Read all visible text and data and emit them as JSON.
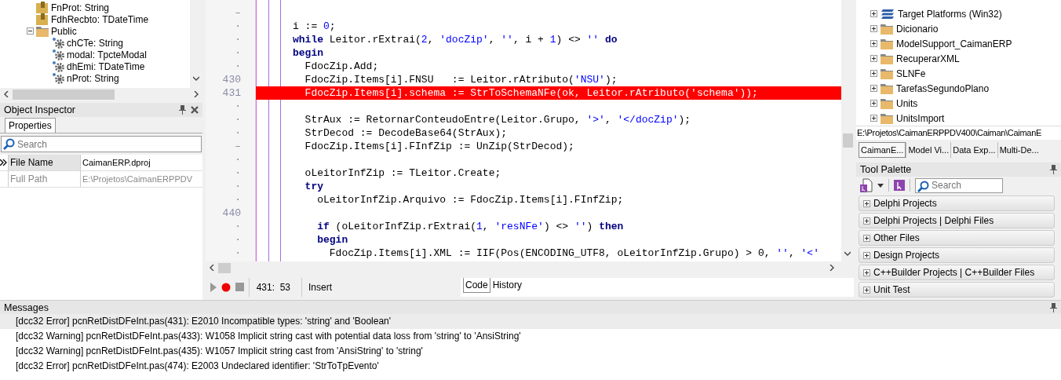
{
  "structure_tree": {
    "items": [
      {
        "label": "FnProt: String",
        "kind": "field"
      },
      {
        "label": "FdhRecbto: TDateTime",
        "kind": "field"
      },
      {
        "label": "Public",
        "kind": "folder",
        "expanded": true,
        "children": [
          {
            "label": "chCTe: String",
            "kind": "property"
          },
          {
            "label": "modal: TpcteModal",
            "kind": "property"
          },
          {
            "label": "dhEmi: TDateTime",
            "kind": "property"
          },
          {
            "label": "nProt: String",
            "kind": "property"
          }
        ]
      }
    ]
  },
  "object_inspector": {
    "title": "Object Inspector",
    "tabs": [
      {
        "label": "Properties",
        "selected": true
      }
    ],
    "search": {
      "placeholder": "Search"
    },
    "properties": [
      {
        "name": "File Name",
        "value": "CaimanERP.dproj",
        "selected": true,
        "readonly": false
      },
      {
        "name": "Full Path",
        "value": "E:\\Projetos\\CaimanERPPDV",
        "selected": false,
        "readonly": true
      }
    ]
  },
  "editor": {
    "lines": [
      {
        "gutter": "–",
        "error": false
      },
      {
        "gutter": "·",
        "error": false,
        "tokens": [
          {
            "kind": "plain",
            "text": "i := "
          },
          {
            "kind": "num",
            "text": "0"
          },
          {
            "kind": "plain",
            "text": ";"
          }
        ]
      },
      {
        "gutter": "·",
        "error": false,
        "tokens": [
          {
            "kind": "kw",
            "text": "while"
          },
          {
            "kind": "plain",
            "text": " Leitor.rExtrai("
          },
          {
            "kind": "num",
            "text": "2"
          },
          {
            "kind": "plain",
            "text": ", "
          },
          {
            "kind": "str",
            "text": "'docZip'"
          },
          {
            "kind": "plain",
            "text": ", "
          },
          {
            "kind": "str",
            "text": "''"
          },
          {
            "kind": "plain",
            "text": ", i + "
          },
          {
            "kind": "num",
            "text": "1"
          },
          {
            "kind": "plain",
            "text": ") <> "
          },
          {
            "kind": "str",
            "text": "''"
          },
          {
            "kind": "kw",
            "text": " do"
          }
        ]
      },
      {
        "gutter": "·",
        "error": false,
        "tokens": [
          {
            "kind": "kw",
            "text": "begin"
          }
        ]
      },
      {
        "gutter": "·",
        "error": false,
        "tokens": [
          {
            "kind": "plain",
            "text": "  FdocZip.Add;"
          }
        ]
      },
      {
        "gutter": "430",
        "error": false,
        "tokens": [
          {
            "kind": "plain",
            "text": "  FdocZip.Items[i].FNSU   := Leitor.rAtributo("
          },
          {
            "kind": "str",
            "text": "'NSU'"
          },
          {
            "kind": "plain",
            "text": ");"
          }
        ]
      },
      {
        "gutter": "431",
        "error": true,
        "tokens": [
          {
            "kind": "plain",
            "text": "  FdocZip.Items[i].schema := StrToSchemaNFe(ok, Leitor.rAtributo("
          },
          {
            "kind": "str",
            "text": "'schema'"
          },
          {
            "kind": "plain",
            "text": "));"
          }
        ]
      },
      {
        "gutter": "·",
        "error": false
      },
      {
        "gutter": "·",
        "error": false,
        "tokens": [
          {
            "kind": "plain",
            "text": "  StrAux := RetornarConteudoEntre(Leitor.Grupo, "
          },
          {
            "kind": "str",
            "text": "'>'"
          },
          {
            "kind": "plain",
            "text": ", "
          },
          {
            "kind": "str",
            "text": "'</docZip'"
          },
          {
            "kind": "plain",
            "text": ");"
          }
        ]
      },
      {
        "gutter": "·",
        "error": false,
        "tokens": [
          {
            "kind": "plain",
            "text": "  StrDecod := DecodeBase64(StrAux);"
          }
        ]
      },
      {
        "gutter": "–",
        "error": false,
        "tokens": [
          {
            "kind": "plain",
            "text": "  FdocZip.Items[i].FInfZip := UnZip(StrDecod);"
          }
        ]
      },
      {
        "gutter": "·",
        "error": false
      },
      {
        "gutter": "·",
        "error": false,
        "tokens": [
          {
            "kind": "plain",
            "text": "  oLeitorInfZip := TLeitor.Create;"
          }
        ]
      },
      {
        "gutter": "·",
        "error": false,
        "tokens": [
          {
            "kind": "kw",
            "text": "  try"
          }
        ]
      },
      {
        "gutter": "·",
        "error": false,
        "tokens": [
          {
            "kind": "plain",
            "text": "    oLeitorInfZip.Arquivo := FdocZip.Items[i].FInfZip;"
          }
        ]
      },
      {
        "gutter": "440",
        "error": false
      },
      {
        "gutter": "·",
        "error": false,
        "tokens": [
          {
            "kind": "kw",
            "text": "    if"
          },
          {
            "kind": "plain",
            "text": " (oLeitorInfZip.rExtrai("
          },
          {
            "kind": "num",
            "text": "1"
          },
          {
            "kind": "plain",
            "text": ", "
          },
          {
            "kind": "str",
            "text": "'resNFe'"
          },
          {
            "kind": "plain",
            "text": ") <> "
          },
          {
            "kind": "str",
            "text": "''"
          },
          {
            "kind": "plain",
            "text": ") "
          },
          {
            "kind": "kw",
            "text": "then"
          }
        ]
      },
      {
        "gutter": "·",
        "error": false,
        "tokens": [
          {
            "kind": "kw",
            "text": "    begin"
          }
        ]
      },
      {
        "gutter": "·",
        "error": false,
        "tokens": [
          {
            "kind": "plain",
            "text": "      FdocZip.Items[i].XML := IIF(Pos(ENCODING_UTF8, oLeitorInfZip.Grupo) > 0, "
          },
          {
            "kind": "str",
            "text": "''"
          },
          {
            "kind": "plain",
            "text": ", "
          },
          {
            "kind": "str",
            "text": "'<'"
          }
        ]
      }
    ],
    "status": {
      "position": "431:  53",
      "mode": "Insert"
    },
    "tabs": [
      {
        "label": "Code",
        "selected": true
      },
      {
        "label": "History",
        "selected": false
      }
    ]
  },
  "project_tree": {
    "items": [
      {
        "label": "Target Platforms (Win32)",
        "kind": "platforms",
        "expanded": false
      },
      {
        "label": "Dicionario",
        "kind": "folder",
        "expanded": false
      },
      {
        "label": "ModelSupport_CaimanERP",
        "kind": "folder",
        "expanded": false
      },
      {
        "label": "RecuperarXML",
        "kind": "folder",
        "expanded": false
      },
      {
        "label": "SLNFe",
        "kind": "folder",
        "expanded": false
      },
      {
        "label": "TarefasSegundoPlano",
        "kind": "folder",
        "expanded": false
      },
      {
        "label": "Units",
        "kind": "folder",
        "expanded": false
      },
      {
        "label": "UnitsImport",
        "kind": "folder",
        "expanded": false
      }
    ],
    "path": "E:\\Projetos\\CaimanERPPDV400\\Caiman\\CaimanE",
    "tabs": [
      {
        "label": "CaimanE...",
        "selected": true
      },
      {
        "label": "Model Vi...",
        "selected": false
      },
      {
        "label": "Data Exp...",
        "selected": false
      },
      {
        "label": "Multi-De...",
        "selected": false
      }
    ]
  },
  "tool_palette": {
    "title": "Tool Palette",
    "search": {
      "placeholder": "Search"
    },
    "categories": [
      {
        "label": "Delphi Projects",
        "expanded": false
      },
      {
        "label": "Delphi Projects | Delphi Files",
        "expanded": false
      },
      {
        "label": "Other Files",
        "expanded": false
      },
      {
        "label": "Design Projects",
        "expanded": false
      },
      {
        "label": "C++Builder Projects | C++Builder Files",
        "expanded": false
      },
      {
        "label": "Unit Test",
        "expanded": false
      }
    ]
  },
  "messages": {
    "title": "Messages",
    "items": [
      {
        "text": "[dcc32 Error] pcnRetDistDFeInt.pas(431): E2010 Incompatible types: 'string' and 'Boolean'",
        "selected": true
      },
      {
        "text": "[dcc32 Warning] pcnRetDistDFeInt.pas(433): W1058 Implicit string cast with potential data loss from 'string' to 'AnsiString'",
        "selected": false
      },
      {
        "text": "[dcc32 Warning] pcnRetDistDFeInt.pas(435): W1057 Implicit string cast from 'AnsiString' to 'string'",
        "selected": false
      },
      {
        "text": "[dcc32 Error] pcnRetDistDFeInt.pas(474): E2003 Undeclared identifier: 'StrToTpEvento'",
        "selected": false
      }
    ]
  }
}
